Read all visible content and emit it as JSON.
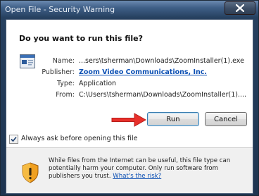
{
  "window": {
    "title": "Open File - Security Warning"
  },
  "dialog": {
    "question": "Do you want to run this file?",
    "fields": [
      {
        "label": "Name:",
        "value": "...sers\\tsherman\\Downloads\\ZoomInstaller(1).exe"
      },
      {
        "label": "Publisher:",
        "value": "Zoom Video Communications, Inc."
      },
      {
        "label": "Type:",
        "value": "Application"
      },
      {
        "label": "From:",
        "value": "C:\\Users\\tsherman\\Downloads\\ZoomInstaller(1)...."
      }
    ],
    "run_label": "Run",
    "cancel_label": "Cancel",
    "checkbox_label": "Always ask before opening this file",
    "checkbox_checked": true,
    "footer_text": "While files from the Internet can be useful, this file type can potentially harm your computer. Only run software from publishers you trust.",
    "footer_link": "What's the risk?"
  },
  "icons": {
    "close": "close-icon",
    "app": "application-icon",
    "shield": "security-shield-icon",
    "arrow": "red-arrow-icon",
    "check": "checkmark-icon"
  },
  "colors": {
    "link": "#0b4fb3",
    "arrow": "#e8302b",
    "shield_orange": "#f0a020"
  }
}
